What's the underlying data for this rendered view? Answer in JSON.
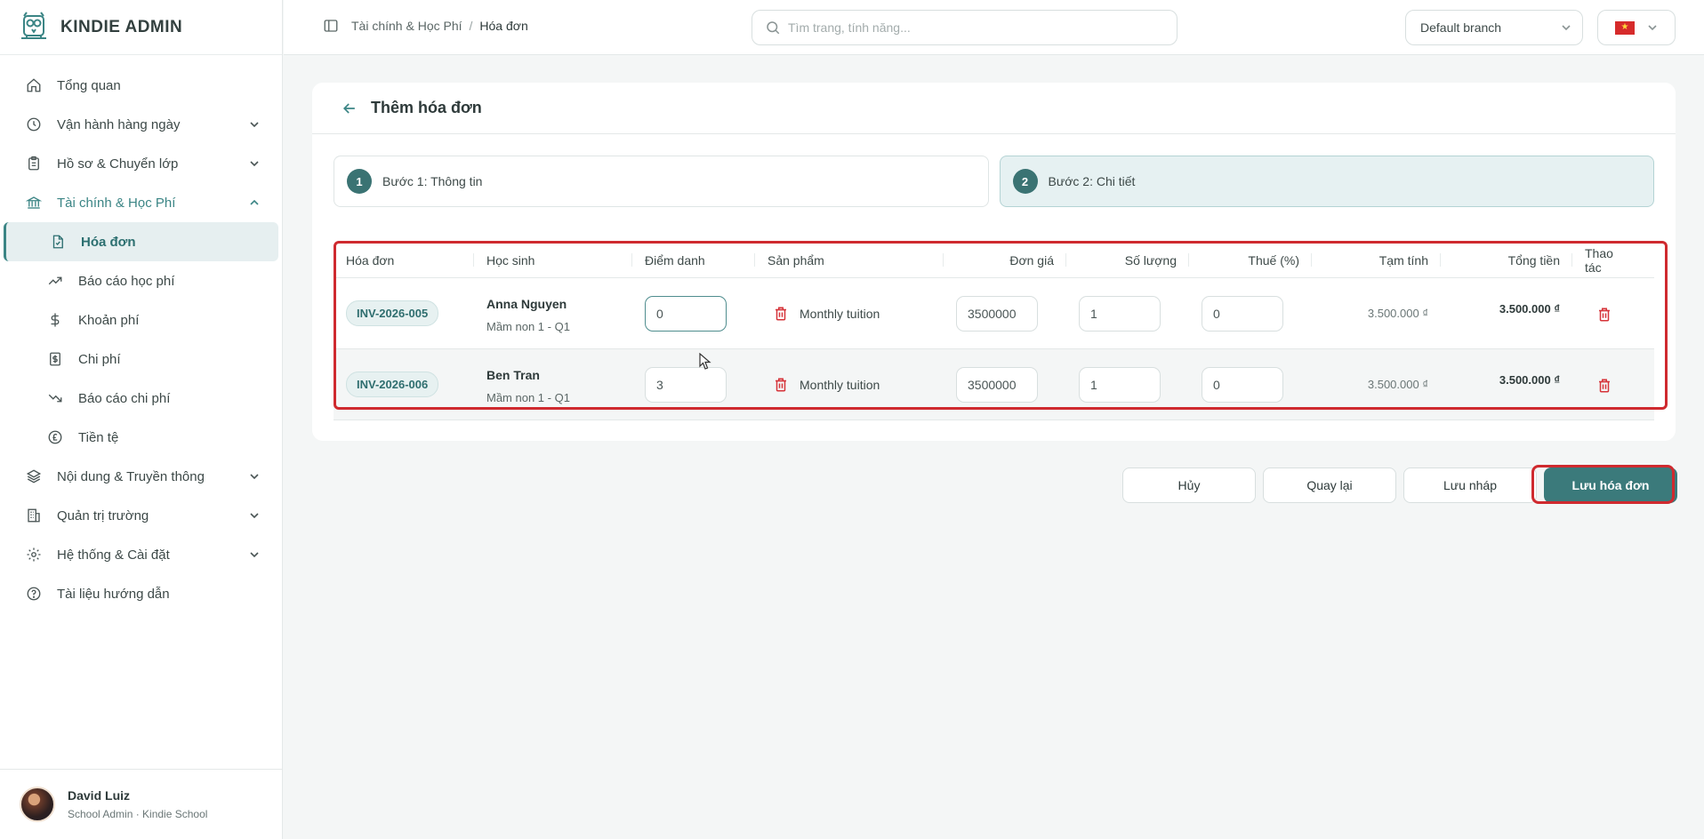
{
  "brand": {
    "name": "KINDIE ADMIN"
  },
  "sidebar": {
    "items": [
      {
        "label": "Tổng quan",
        "icon": "home-icon"
      },
      {
        "label": "Vận hành hàng ngày",
        "icon": "clock-icon"
      },
      {
        "label": "Hồ sơ & Chuyển lớp",
        "icon": "clipboard-icon"
      },
      {
        "label": "Tài chính & Học Phí",
        "icon": "bank-icon"
      },
      {
        "label": "Nội dung & Truyền thông",
        "icon": "layers-icon"
      },
      {
        "label": "Quản trị trường",
        "icon": "building-icon"
      },
      {
        "label": "Hệ thống & Cài đặt",
        "icon": "gear-icon"
      },
      {
        "label": "Tài liệu hướng dẫn",
        "icon": "help-circle-icon"
      }
    ],
    "finance_sub": [
      {
        "label": "Hóa đơn",
        "icon": "invoice-file-icon"
      },
      {
        "label": "Báo cáo học phí",
        "icon": "trend-up-icon"
      },
      {
        "label": "Khoản phí",
        "icon": "dollar-icon"
      },
      {
        "label": "Chi phí",
        "icon": "receipt-dollar-icon"
      },
      {
        "label": "Báo cáo chi phí",
        "icon": "trend-down-icon"
      },
      {
        "label": "Tiền tệ",
        "icon": "pound-circle-icon"
      }
    ]
  },
  "user": {
    "name": "David Luiz",
    "role": "School Admin · Kindie School"
  },
  "header": {
    "breadcrumb": [
      "Tài chính & Học Phí",
      "Hóa đơn"
    ],
    "search_placeholder": "Tìm trang, tính năng...",
    "branch": "Default branch"
  },
  "page": {
    "title": "Thêm hóa đơn",
    "steps": [
      {
        "num": "1",
        "label": "Bước 1: Thông tin"
      },
      {
        "num": "2",
        "label": "Bước 2: Chi tiết"
      }
    ]
  },
  "table": {
    "headers": [
      "Hóa đơn",
      "Học sinh",
      "Điểm danh",
      "Sản phẩm",
      "Đơn giá",
      "Số lượng",
      "Thuế (%)",
      "Tạm tính",
      "Tổng tiền",
      "Thao tác"
    ],
    "rows": [
      {
        "invoice": "INV-2026-005",
        "student": "Anna Nguyen",
        "class": "Mầm non 1 - Q1",
        "attendance": "0",
        "product": "Monthly tuition",
        "price": "3500000",
        "qty": "1",
        "tax": "0",
        "subtotal": "3.500.000 ₫",
        "total": "3.500.000 ₫"
      },
      {
        "invoice": "INV-2026-006",
        "student": "Ben Tran",
        "class": "Mầm non 1 - Q1",
        "attendance": "3",
        "product": "Monthly tuition",
        "price": "3500000",
        "qty": "1",
        "tax": "0",
        "subtotal": "3.500.000 ₫",
        "total": "3.500.000 ₫"
      }
    ]
  },
  "actions": {
    "cancel": "Hủy",
    "back": "Quay lại",
    "draft": "Lưu nháp",
    "save": "Lưu hóa đơn"
  },
  "colors": {
    "accent": "#3b7a7b",
    "highlight": "#cf2a2f",
    "danger": "#d6343a"
  }
}
